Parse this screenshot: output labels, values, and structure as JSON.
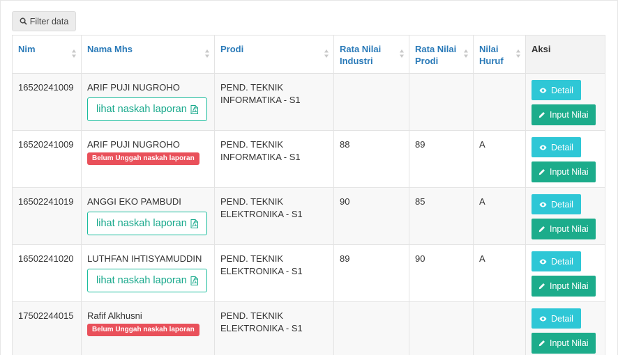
{
  "toolbar": {
    "filter_label": "Filter data",
    "filter_icon": "search-icon"
  },
  "table": {
    "headers": {
      "nim": "Nim",
      "nama": "Nama Mhs",
      "prodi": "Prodi",
      "rata_industri": "Rata Nilai Industri",
      "rata_prodi": "Rata Nilai Prodi",
      "nilai_huruf": "Nilai Huruf",
      "aksi": "Aksi"
    },
    "rows": [
      {
        "nim": "16520241009",
        "nama": "ARIF PUJI NUGROHO",
        "naskah": "lihat naskah laporan",
        "prodi": "PEND. TEKNIK INFORMATIKA - S1",
        "rata_industri": "",
        "rata_prodi": "",
        "nilai_huruf": "",
        "detail": "Detail",
        "input": "Input Nilai"
      },
      {
        "nim": "16520241009",
        "nama": "ARIF PUJI NUGROHO",
        "badge": "Belum Unggah naskah laporan",
        "prodi": "PEND. TEKNIK INFORMATIKA - S1",
        "rata_industri": "88",
        "rata_prodi": "89",
        "nilai_huruf": "A",
        "detail": "Detail",
        "input": "Input Nilai"
      },
      {
        "nim": "16502241019",
        "nama": "ANGGI EKO PAMBUDI",
        "naskah": "lihat naskah laporan",
        "prodi": "PEND. TEKNIK ELEKTRONIKA - S1",
        "rata_industri": "90",
        "rata_prodi": "85",
        "nilai_huruf": "A",
        "detail": "Detail",
        "input": "Input Nilai"
      },
      {
        "nim": "16502241020",
        "nama": "LUTHFAN IHTISYAMUDDIN",
        "naskah": "lihat naskah laporan",
        "prodi": "PEND. TEKNIK ELEKTRONIKA - S1",
        "rata_industri": "89",
        "rata_prodi": "90",
        "nilai_huruf": "A",
        "detail": "Detail",
        "input": "Input Nilai"
      },
      {
        "nim": "17502244015",
        "nama": "Rafif Alkhusni",
        "badge": "Belum Unggah naskah laporan",
        "prodi": "PEND. TEKNIK ELEKTRONIKA - S1",
        "rata_industri": "",
        "rata_prodi": "",
        "nilai_huruf": "",
        "detail": "Detail",
        "input": "Input Nilai"
      }
    ]
  },
  "colors": {
    "header_text": "#2a7ab8",
    "naskah_outline": "#1abc9c",
    "badge_red": "#e9505a",
    "detail_cyan": "#2ec7d6",
    "input_green": "#1cac8b"
  },
  "icons": {
    "sort": "sort-icon",
    "pdf": "pdf-file-icon",
    "detail": "eye-icon",
    "input": "pencil-icon"
  }
}
